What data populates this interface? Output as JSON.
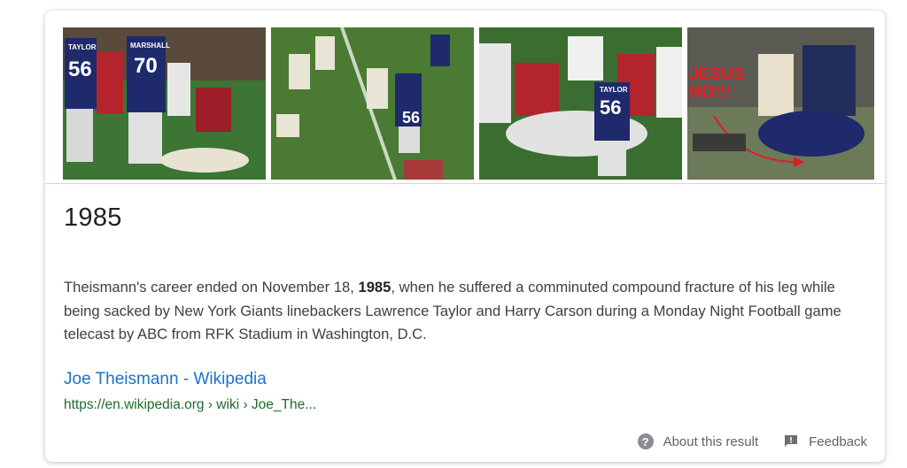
{
  "images": [
    {
      "alt": "Giants players 56 and 70 standing near injured player"
    },
    {
      "alt": "Play on the field with Giants defender 56"
    },
    {
      "alt": "Players and medics gathered around injured player"
    },
    {
      "alt": "Replay of the tackle with red annotation"
    }
  ],
  "image_texts": {
    "img1_numbers": [
      "56",
      "70"
    ],
    "img1_names": [
      "TAYLOR",
      "MARSHALL"
    ],
    "img2_number": "56",
    "img3_number": "56",
    "img3_name": "TAYLOR",
    "img4_overlay": "JESUS NO!!!"
  },
  "answer": {
    "title": "1985"
  },
  "snippet": {
    "before": "Theismann's career ended on November 18, ",
    "bold": "1985",
    "after": ", when he suffered a comminuted compound fracture of his leg while being sacked by New York Giants linebackers Lawrence Taylor and Harry Carson during a Monday Night Football game telecast by ABC from RFK Stadium in Washington, D.C."
  },
  "source": {
    "title": "Joe Theismann - Wikipedia",
    "url": "https://en.wikipedia.org › wiki › Joe_The..."
  },
  "footer": {
    "about_label": "About this result",
    "feedback_label": "Feedback"
  },
  "colors": {
    "link": "#1a73c9",
    "url": "#1e6b2a",
    "text": "#3c4043"
  },
  "icons": {
    "about": "help-circle-icon",
    "feedback": "feedback-icon"
  }
}
